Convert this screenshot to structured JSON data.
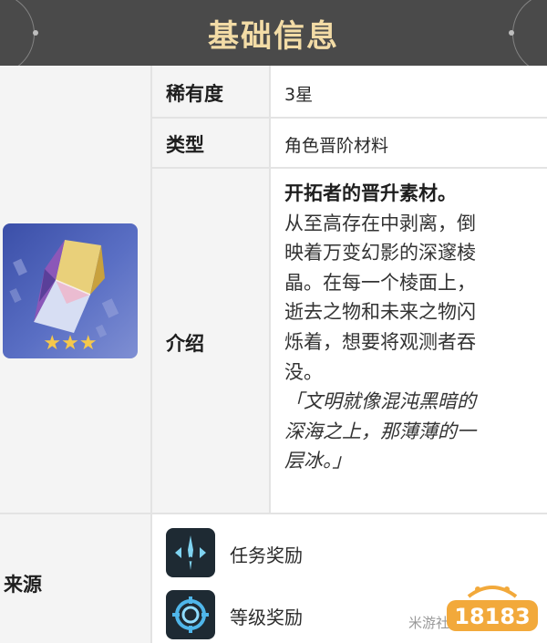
{
  "header": {
    "title": "基础信息"
  },
  "table": {
    "rarity": {
      "label": "稀有度",
      "value": "3星"
    },
    "type": {
      "label": "类型",
      "value": "角色晋阶材料"
    },
    "intro": {
      "label": "介绍",
      "title": "开拓者的晋升素材。",
      "lines": [
        "从至高存在中剥离，倒",
        "映着万变幻影的深邃棱",
        "晶。在每一个棱面上，",
        "逝去之物和未来之物闪",
        "烁着，想要将观测者吞",
        "没。"
      ],
      "quote_lines": [
        "「文明就像混沌黑暗的",
        "深海之上，那薄薄的一",
        "层冰。」"
      ]
    },
    "source": {
      "label": "来源",
      "items": [
        {
          "label": "任务奖励",
          "icon": "mission-icon"
        },
        {
          "label": "等级奖励",
          "icon": "level-reward-icon"
        }
      ]
    }
  },
  "item": {
    "rarity_stars": 3,
    "icon": "crystal-item-icon",
    "star_color": "#f5c84b"
  },
  "watermark": {
    "site_text": "米游社",
    "logo_text": "18183"
  },
  "colors": {
    "header_bg": "#4a4a4a",
    "header_text": "#f3dca6",
    "label_bg": "#f4f4f4",
    "border": "#e3e3e3"
  }
}
